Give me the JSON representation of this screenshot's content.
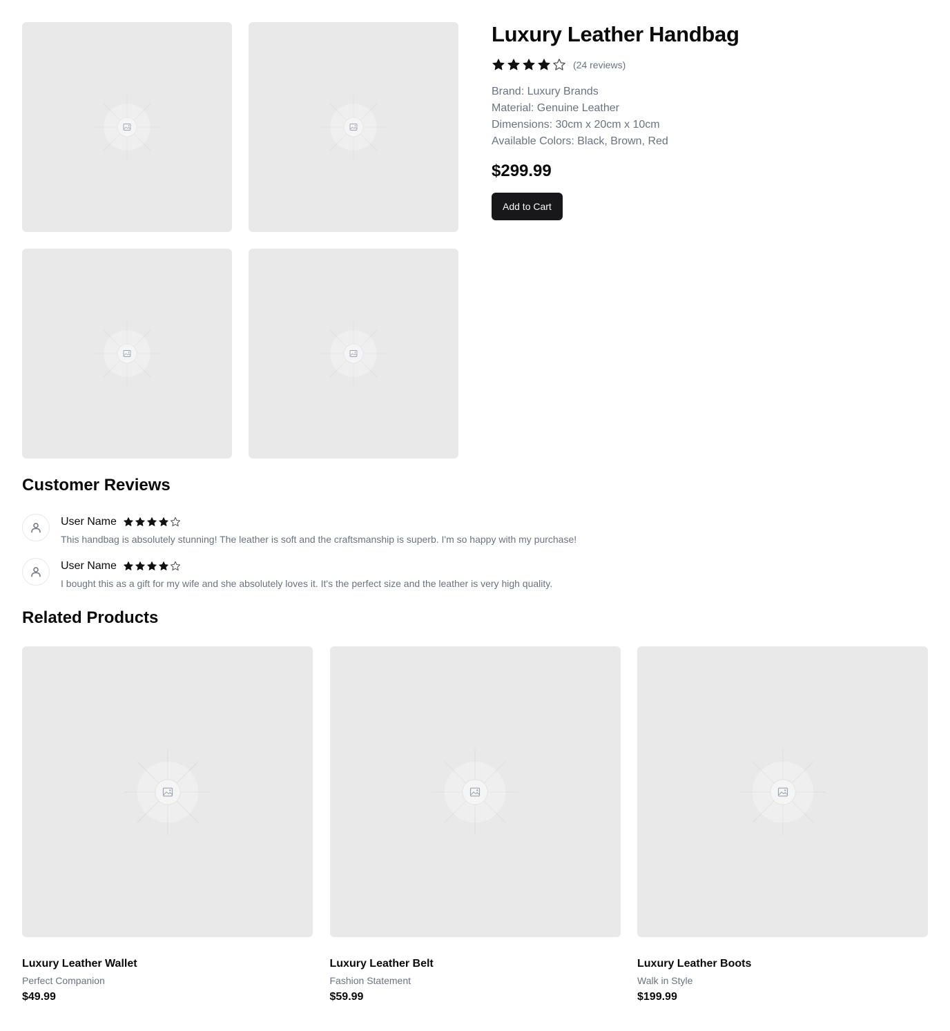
{
  "product": {
    "title": "Luxury Leather Handbag",
    "rating": 4,
    "max_rating": 5,
    "review_count_text": "(24 reviews)",
    "specs": [
      "Brand: Luxury Brands",
      "Material: Genuine Leather",
      "Dimensions: 30cm x 20cm x 10cm",
      "Available Colors: Black, Brown, Red"
    ],
    "price": "$299.99",
    "add_to_cart_label": "Add to Cart",
    "gallery_image_count": 4
  },
  "reviews": {
    "title": "Customer Reviews",
    "items": [
      {
        "user": "User Name",
        "rating": 4,
        "text": "This handbag is absolutely stunning! The leather is soft and the craftsmanship is superb. I'm so happy with my purchase!",
        "avatar_icon": "user-icon"
      },
      {
        "user": "User Name",
        "rating": 4,
        "text": "I bought this as a gift for my wife and she absolutely loves it. It's the perfect size and the leather is very high quality.",
        "avatar_icon": "user-icon"
      }
    ]
  },
  "related": {
    "title": "Related Products",
    "items": [
      {
        "name": "Luxury Leather Wallet",
        "subtitle": "Perfect Companion",
        "price": "$49.99"
      },
      {
        "name": "Luxury Leather Belt",
        "subtitle": "Fashion Statement",
        "price": "$59.99"
      },
      {
        "name": "Luxury Leather Boots",
        "subtitle": "Walk in Style",
        "price": "$199.99"
      }
    ]
  },
  "colors": {
    "button_bg": "#18181b",
    "button_text": "#fafafa",
    "placeholder_bg": "#e9e9e9",
    "muted_text": "#6b7280",
    "star_fill": "#111111"
  },
  "icons": {
    "star_full": "star-filled-icon",
    "star_empty": "star-outline-icon",
    "placeholder": "image-placeholder-icon",
    "avatar": "user-icon"
  }
}
